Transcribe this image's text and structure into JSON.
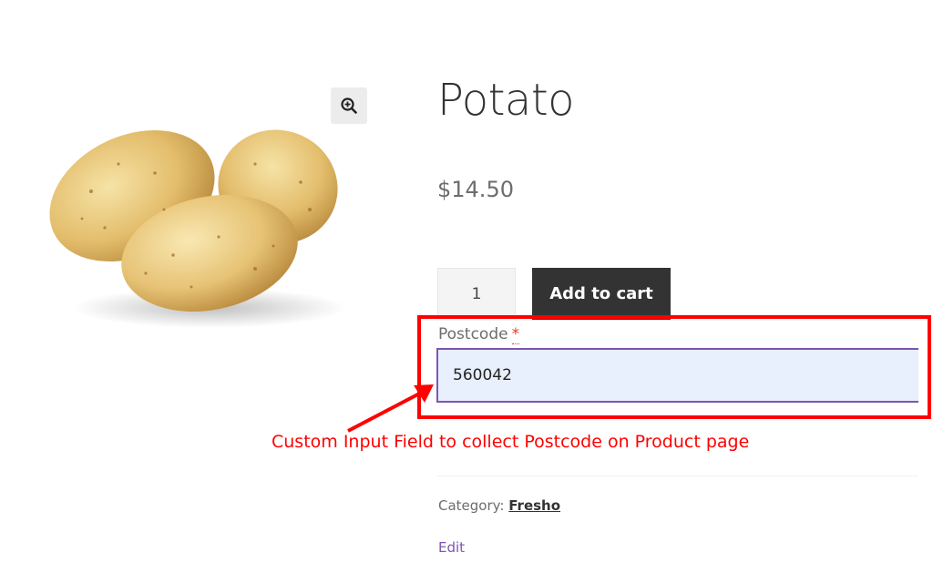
{
  "product": {
    "title": "Potato",
    "price": "$14.50",
    "quantity": "1",
    "add_to_cart_label": "Add to cart"
  },
  "postcode": {
    "label": "Postcode",
    "required_marker": "*",
    "value": "560042"
  },
  "annotation": {
    "text": "Custom Input Field to collect Postcode on Product page",
    "color": "#ff0000"
  },
  "meta": {
    "category_label": "Category:",
    "category_value": "Fresho",
    "edit_label": "Edit"
  },
  "icons": {
    "zoom": "zoom-in-icon"
  },
  "colors": {
    "accent": "#7f54b3",
    "button": "#333333",
    "required": "#e2401c"
  }
}
